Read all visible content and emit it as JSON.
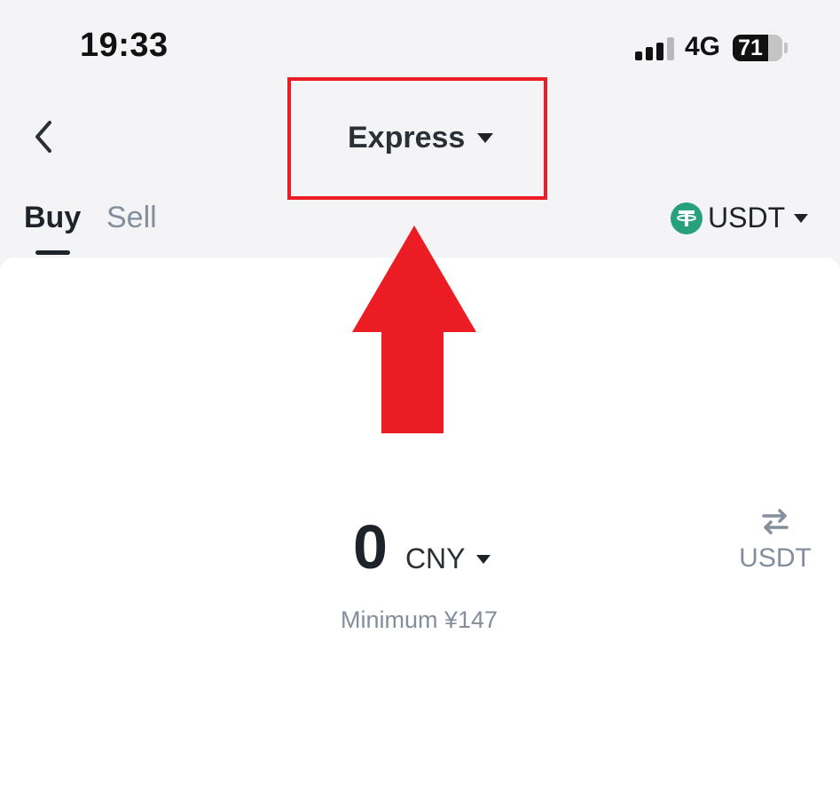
{
  "status_bar": {
    "time": "19:33",
    "network": "4G",
    "battery": "71",
    "battery_level": 0.71,
    "signal_bars_filled": 3,
    "signal_bars_total": 4
  },
  "header": {
    "back_icon": "chevron-left-icon",
    "mode_label": "Express",
    "highlight_color": "#e81d25"
  },
  "tabs": {
    "buy": "Buy",
    "sell": "Sell",
    "active": "Buy"
  },
  "asset": {
    "label": "USDT",
    "icon": "tether-icon",
    "icon_color": "#26a17b"
  },
  "amount": {
    "value": "0",
    "currency": "CNY",
    "minimum": "Minimum ¥147"
  },
  "switch": {
    "icon": "swap-arrows-icon",
    "label": "USDT"
  },
  "annotation": {
    "arrow_icon": "up-arrow-icon",
    "arrow_color": "#ec1c24"
  }
}
